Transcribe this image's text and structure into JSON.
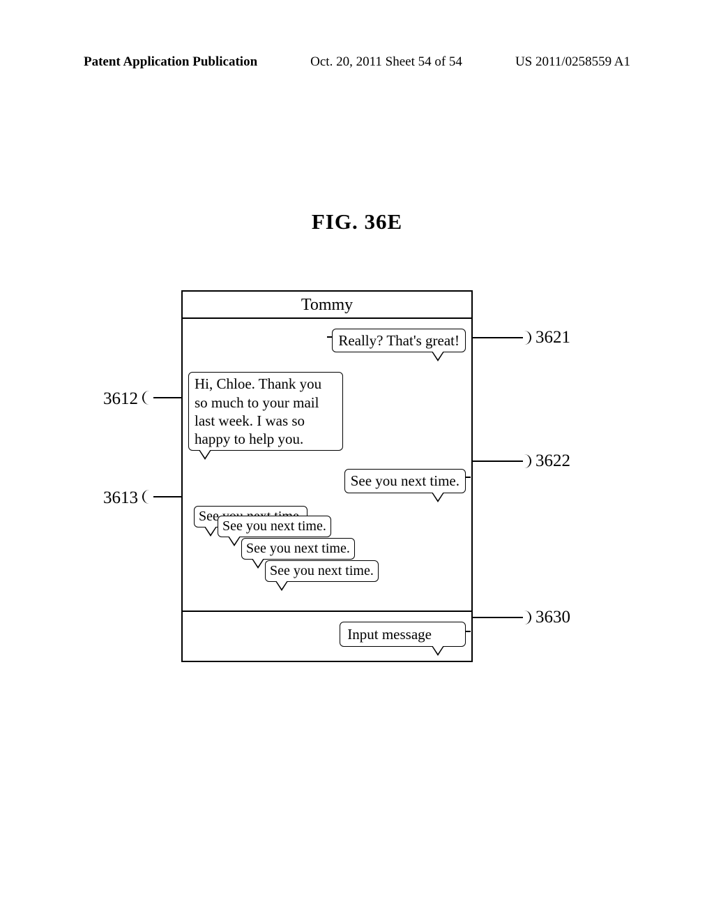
{
  "header": {
    "left": "Patent Application Publication",
    "mid": "Oct. 20, 2011  Sheet 54 of 54",
    "right": "US 2011/0258559 A1"
  },
  "figure_title": "FIG. 36E",
  "phone": {
    "title": "Tommy",
    "bubble_3621": "Really? That's great!",
    "bubble_3612": "Hi, Chloe. Thank you so much to your mail last week. I was so happy to help you.",
    "bubble_3622": "See you next time.",
    "bubble_3613_1": "See you next time.",
    "bubble_3613_2": "See you next time.",
    "bubble_3613_3": "See you next time.",
    "bubble_3613_4": "See you next time.",
    "input_3630": "Input message"
  },
  "labels": {
    "l3621": "3621",
    "l3612": "3612",
    "l3622": "3622",
    "l3613": "3613",
    "l3630": "3630"
  }
}
